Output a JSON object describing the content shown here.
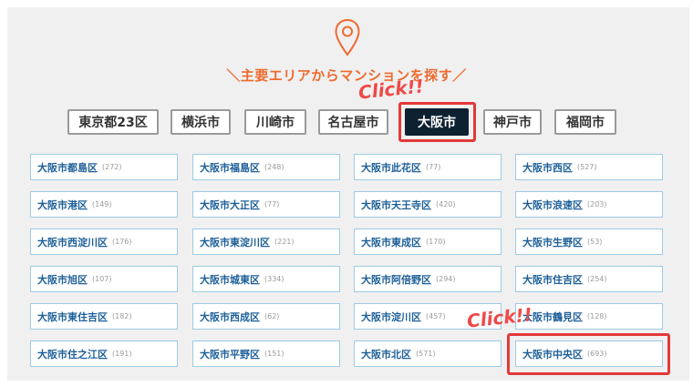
{
  "heading": "＼主要エリアからマンションを探す／",
  "annotations": {
    "click_label_1": "Click!!",
    "click_label_2": "Click!!",
    "highlight_color": "#e3393a"
  },
  "icons": {
    "location": "map-pin-icon"
  },
  "colors": {
    "accent": "#ee6a2f",
    "active_tab": "#0d2131",
    "ward_text": "#1d5f99",
    "ward_border": "#9ccbe6"
  },
  "tabs": [
    {
      "label": "東京都23区",
      "active": false
    },
    {
      "label": "横浜市",
      "active": false
    },
    {
      "label": "川崎市",
      "active": false
    },
    {
      "label": "名古屋市",
      "active": false
    },
    {
      "label": "大阪市",
      "active": true
    },
    {
      "label": "神戸市",
      "active": false
    },
    {
      "label": "福岡市",
      "active": false
    }
  ],
  "wards": [
    {
      "name": "大阪市都島区",
      "count": "(272)"
    },
    {
      "name": "大阪市福島区",
      "count": "(248)"
    },
    {
      "name": "大阪市此花区",
      "count": "(77)"
    },
    {
      "name": "大阪市西区",
      "count": "(527)"
    },
    {
      "name": "大阪市港区",
      "count": "(149)"
    },
    {
      "name": "大阪市大正区",
      "count": "(77)"
    },
    {
      "name": "大阪市天王寺区",
      "count": "(420)"
    },
    {
      "name": "大阪市浪速区",
      "count": "(203)"
    },
    {
      "name": "大阪市西淀川区",
      "count": "(176)"
    },
    {
      "name": "大阪市東淀川区",
      "count": "(221)"
    },
    {
      "name": "大阪市東成区",
      "count": "(170)"
    },
    {
      "name": "大阪市生野区",
      "count": "(53)"
    },
    {
      "name": "大阪市旭区",
      "count": "(107)"
    },
    {
      "name": "大阪市城東区",
      "count": "(334)"
    },
    {
      "name": "大阪市阿倍野区",
      "count": "(294)"
    },
    {
      "name": "大阪市住吉区",
      "count": "(254)"
    },
    {
      "name": "大阪市東住吉区",
      "count": "(182)"
    },
    {
      "name": "大阪市西成区",
      "count": "(62)"
    },
    {
      "name": "大阪市淀川区",
      "count": "(457)"
    },
    {
      "name": "大阪市鶴見区",
      "count": "(128)"
    },
    {
      "name": "大阪市住之江区",
      "count": "(191)"
    },
    {
      "name": "大阪市平野区",
      "count": "(151)"
    },
    {
      "name": "大阪市北区",
      "count": "(571)"
    },
    {
      "name": "大阪市中央区",
      "count": "(693)"
    }
  ]
}
